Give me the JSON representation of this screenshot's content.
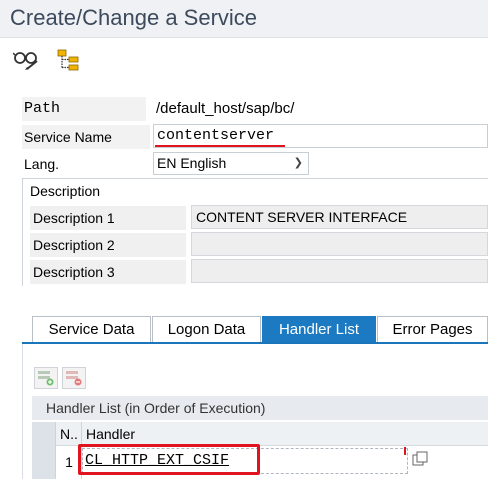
{
  "window": {
    "title": "Create/Change a Service"
  },
  "toolbar": {
    "buttons": [
      {
        "name": "display-change-toggle",
        "icon": "glasses-pencil-icon"
      },
      {
        "name": "hierarchy",
        "icon": "hierarchy-tree-icon"
      }
    ]
  },
  "form": {
    "path_label": "Path",
    "path_value": "/default_host/sap/bc/",
    "service_name_label": "Service Name",
    "service_name_value": "contentserver",
    "lang_label": "Lang.",
    "lang_value": "EN English"
  },
  "description": {
    "header": "Description",
    "rows": [
      {
        "label": "Description 1",
        "value": "CONTENT SERVER INTERFACE"
      },
      {
        "label": "Description 2",
        "value": ""
      },
      {
        "label": "Description 3",
        "value": ""
      }
    ]
  },
  "tabs": [
    {
      "label": "Service Data",
      "active": false
    },
    {
      "label": "Logon Data",
      "active": false
    },
    {
      "label": "Handler List",
      "active": true
    },
    {
      "label": "Error Pages",
      "active": false
    }
  ],
  "handler_list": {
    "title": "Handler List (in Order of Execution)",
    "add_button_icon": "insert-row-icon",
    "delete_button_icon": "delete-row-icon",
    "columns": [
      "N..",
      "Handler"
    ],
    "rows": [
      {
        "no": "1",
        "handler": "CL_HTTP_EXT_CSIF"
      }
    ],
    "value_help_icon": "value-help-icon"
  },
  "colors": {
    "accent": "#1b7ac2",
    "highlight": "#e0141e",
    "title_text": "#3c4a5c"
  }
}
